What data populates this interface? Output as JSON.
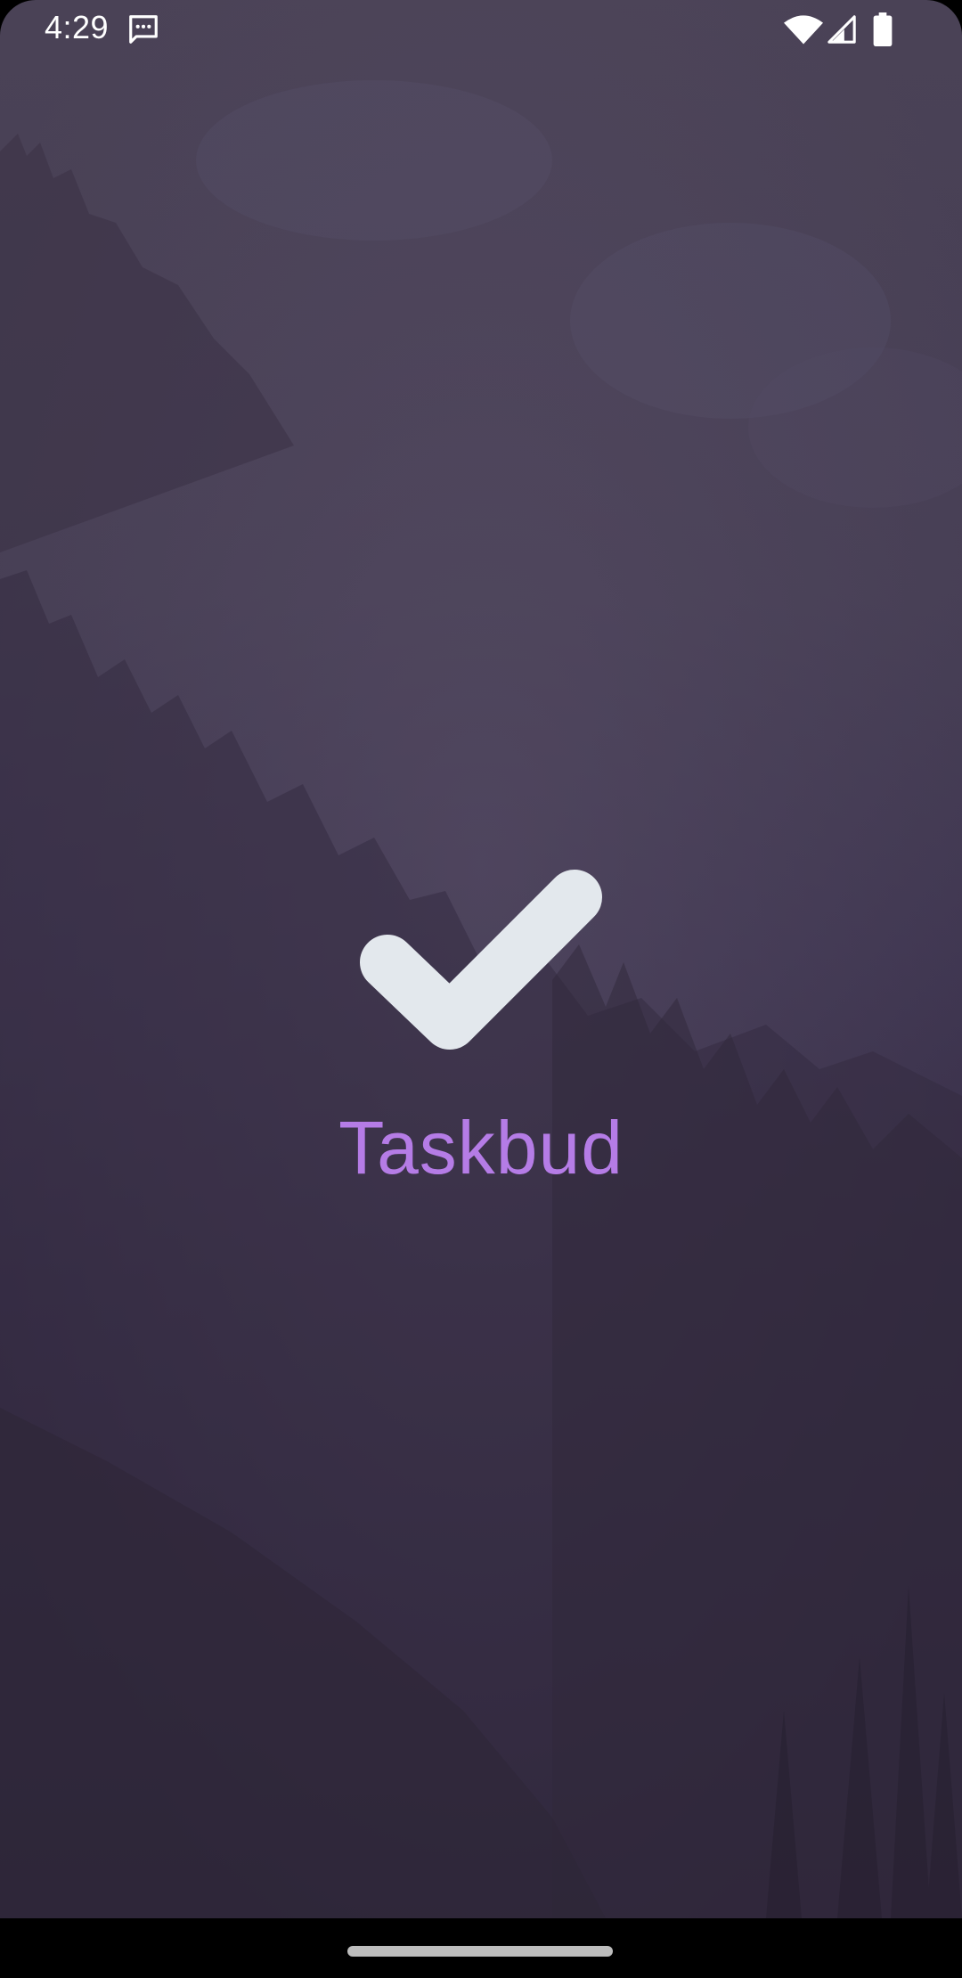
{
  "status_bar": {
    "time": "4:29",
    "icons": [
      "message-icon",
      "wifi-icon",
      "signal-icon",
      "battery-icon"
    ]
  },
  "splash": {
    "logo_icon": "checkmark-icon",
    "app_name": "Taskbud"
  },
  "colors": {
    "app_name_color": "#b57ce6",
    "logo_color": "#e3e8ed",
    "background_tint": "#463e54"
  },
  "navigation": {
    "home_handle": "gesture-home-handle"
  }
}
